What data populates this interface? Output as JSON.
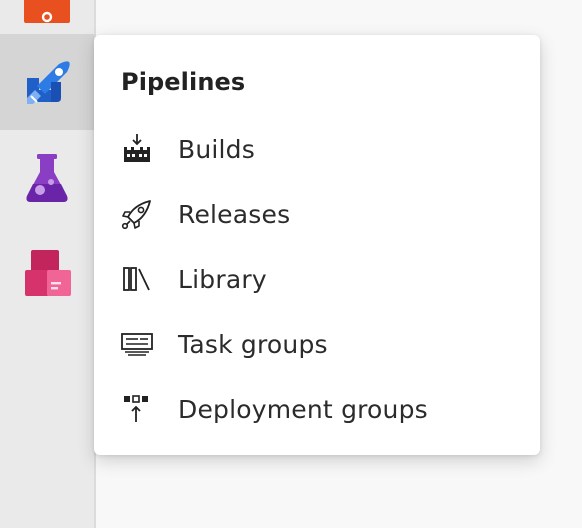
{
  "rail": {
    "items": [
      {
        "name": "overview",
        "icon": "overview-icon"
      },
      {
        "name": "pipelines",
        "icon": "pipelines-icon",
        "selected": true
      },
      {
        "name": "test-plans",
        "icon": "test-plans-icon"
      },
      {
        "name": "artifacts",
        "icon": "artifacts-icon"
      }
    ]
  },
  "flyout": {
    "title": "Pipelines",
    "items": [
      {
        "label": "Builds",
        "icon": "builds-icon"
      },
      {
        "label": "Releases",
        "icon": "releases-icon"
      },
      {
        "label": "Library",
        "icon": "library-icon"
      },
      {
        "label": "Task groups",
        "icon": "task-groups-icon"
      },
      {
        "label": "Deployment groups",
        "icon": "deployment-groups-icon"
      }
    ]
  },
  "colors": {
    "overview_orange": "#e8501f",
    "pipelines_blue": "#2d7be5",
    "test_plans_purple": "#8a3ec4",
    "artifacts_pink": "#d6336c"
  }
}
